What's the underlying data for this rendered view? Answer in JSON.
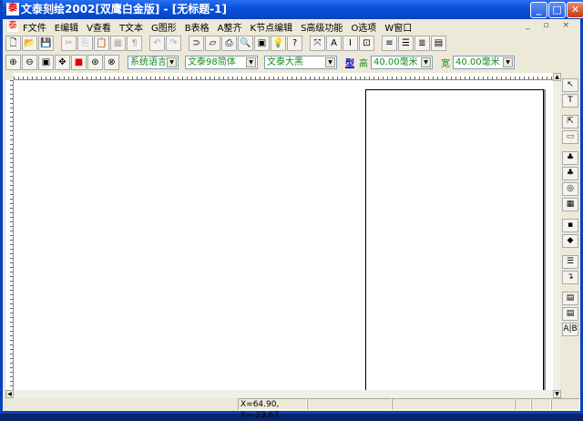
{
  "window": {
    "title": "文泰刻绘2002[双鹰白金版] - [无标题-1]",
    "minimize": "_",
    "maximize": "□",
    "close": "✕"
  },
  "menu": [
    "F文件",
    "E编辑",
    "V查看",
    "T文本",
    "G图形",
    "B表格",
    "A整齐",
    "K节点编辑",
    "S高级功能",
    "O选项",
    "W窗口"
  ],
  "toolbar1": [
    {
      "icon": "new-icon",
      "g": "🗋"
    },
    {
      "icon": "open-icon",
      "g": "📂"
    },
    {
      "icon": "save-icon",
      "g": "💾"
    },
    {
      "icon": "cut-icon",
      "g": "✂",
      "dis": true
    },
    {
      "icon": "copy-icon",
      "g": "⎘",
      "dis": true
    },
    {
      "icon": "paste-icon",
      "g": "📋",
      "dis": true
    },
    {
      "icon": "grid-icon",
      "g": "▦",
      "dis": true
    },
    {
      "icon": "format-icon",
      "g": "¶",
      "dis": true
    },
    {
      "icon": "undo-icon",
      "g": "↶",
      "dis": true
    },
    {
      "icon": "redo-icon",
      "g": "↷",
      "dis": true
    },
    {
      "icon": "scan-icon",
      "g": "⊃"
    },
    {
      "icon": "note-icon",
      "g": "▱"
    },
    {
      "icon": "print-icon",
      "g": "⎙"
    },
    {
      "icon": "preview-icon",
      "g": "🔍"
    },
    {
      "icon": "frame-icon",
      "g": "▣"
    },
    {
      "icon": "bulb-icon",
      "g": "💡"
    },
    {
      "icon": "help-icon",
      "g": "?"
    },
    {
      "icon": "node-icon",
      "g": "⤧"
    },
    {
      "icon": "text-box-icon",
      "g": "A"
    },
    {
      "icon": "italic-icon",
      "g": "I"
    },
    {
      "icon": "text-frame-icon",
      "g": "⊡"
    },
    {
      "icon": "align-left-icon",
      "g": "≡"
    },
    {
      "icon": "align-center-icon",
      "g": "☰"
    },
    {
      "icon": "align-right-icon",
      "g": "≣"
    },
    {
      "icon": "justify-icon",
      "g": "▤"
    }
  ],
  "toolbar2": {
    "tools": [
      {
        "icon": "zoom-in-icon",
        "g": "⊕"
      },
      {
        "icon": "zoom-out-icon",
        "g": "⊖"
      },
      {
        "icon": "zoom-page-icon",
        "g": "▣"
      },
      {
        "icon": "pan-icon",
        "g": "✥"
      },
      {
        "icon": "color-icon",
        "g": "■"
      },
      {
        "icon": "zoom-fit-icon",
        "g": "⊛"
      },
      {
        "icon": "zoom-all-icon",
        "g": "⊗"
      }
    ],
    "language": "系统语言",
    "font_cn": "文泰98简体",
    "font_en": "文泰大黑",
    "style_label": "型",
    "height_label": "高",
    "height_value": "40.00毫米",
    "width_label": "宽",
    "width_value": "40.00毫米"
  },
  "right_toolbar": [
    {
      "icon": "select-icon",
      "g": "↖"
    },
    {
      "icon": "text-tool-icon",
      "g": "T"
    },
    {
      "icon": "pick-node-icon",
      "g": "⇱"
    },
    {
      "icon": "rectangle-icon",
      "g": "▭"
    },
    {
      "icon": "fill-icon",
      "g": "♣"
    },
    {
      "icon": "gradient-icon",
      "g": "♣"
    },
    {
      "icon": "shapes-icon",
      "g": "◎"
    },
    {
      "icon": "table-icon",
      "g": "▦"
    },
    {
      "icon": "palette-icon",
      "g": "▪"
    },
    {
      "icon": "paint-icon",
      "g": "◆"
    },
    {
      "icon": "layers-icon",
      "g": "☰"
    },
    {
      "icon": "exit-icon",
      "g": "↴"
    },
    {
      "icon": "disabled-1-icon",
      "g": "▤"
    },
    {
      "icon": "disabled-2-icon",
      "g": "▤"
    },
    {
      "icon": "text-cursor-icon",
      "g": "A|B"
    }
  ],
  "status": {
    "coords": "X=64.90, Y=-23.67"
  },
  "colors": {
    "title": "#0842c0",
    "accent_green": "#1a8a1a",
    "red": "#e00000"
  }
}
